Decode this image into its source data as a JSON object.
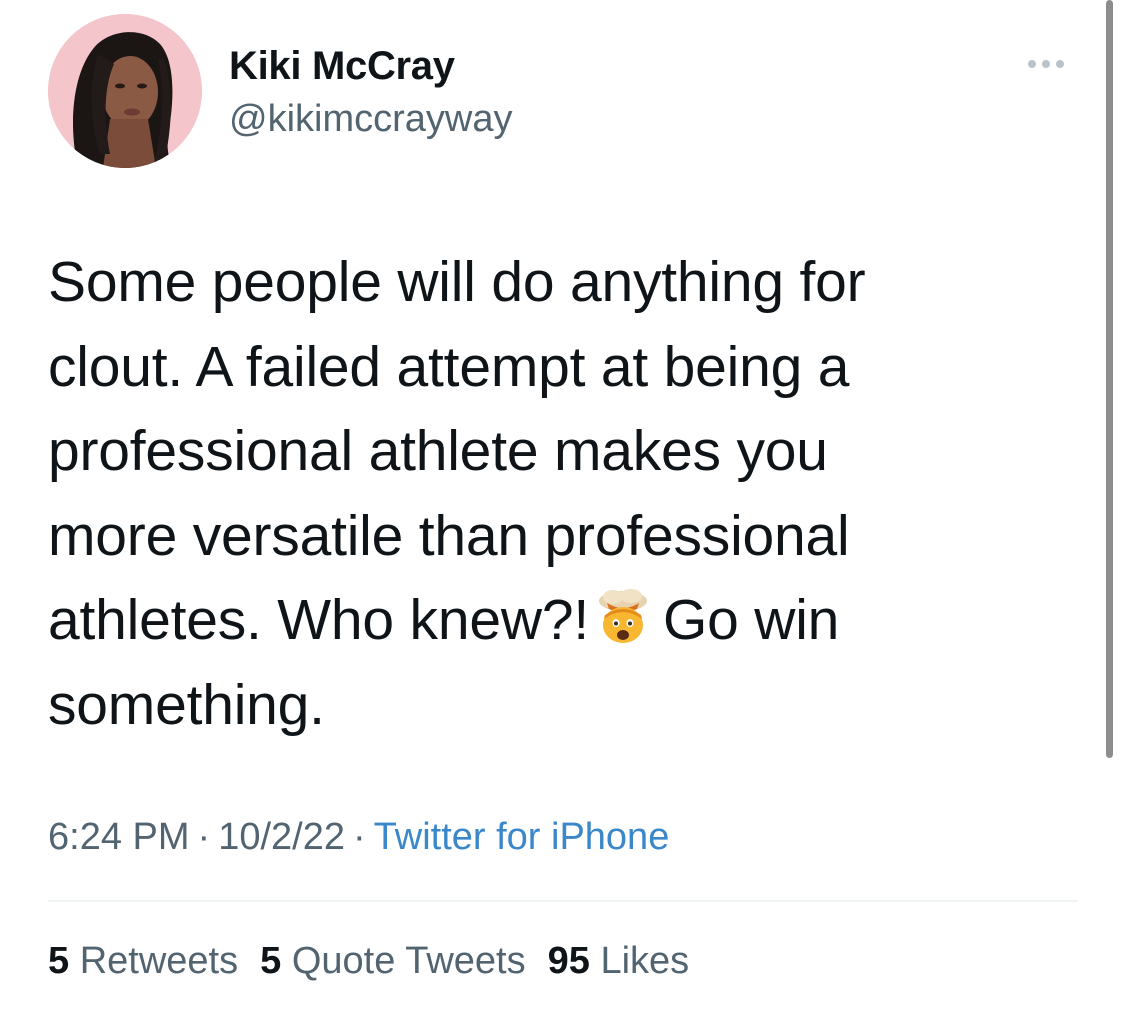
{
  "author": {
    "name": "Kiki McCray",
    "handle": "@kikimccrayway",
    "avatar_bg": "#f4c6cc"
  },
  "menu": {
    "icon": "more-icon"
  },
  "tweet": {
    "lines": [
      "Some people will do anything for",
      "clout. A failed attempt at being a",
      "professional athlete makes you",
      "more versatile than professional",
      "athletes. Who knew?!",
      "something."
    ],
    "line5_after_emoji": "Go win",
    "emoji": "exploding-head-icon"
  },
  "meta": {
    "time": "6:24 PM",
    "date": "10/2/22",
    "source": "Twitter for iPhone",
    "separator": "·"
  },
  "stats": {
    "retweets_count": "5",
    "retweets_label": "Retweets",
    "quotes_count": "5",
    "quotes_label": "Quote Tweets",
    "likes_count": "95",
    "likes_label": "Likes"
  },
  "colors": {
    "text": "#0f1419",
    "secondary": "#536471",
    "link": "#3a87c9",
    "divider": "#eff3f4"
  }
}
